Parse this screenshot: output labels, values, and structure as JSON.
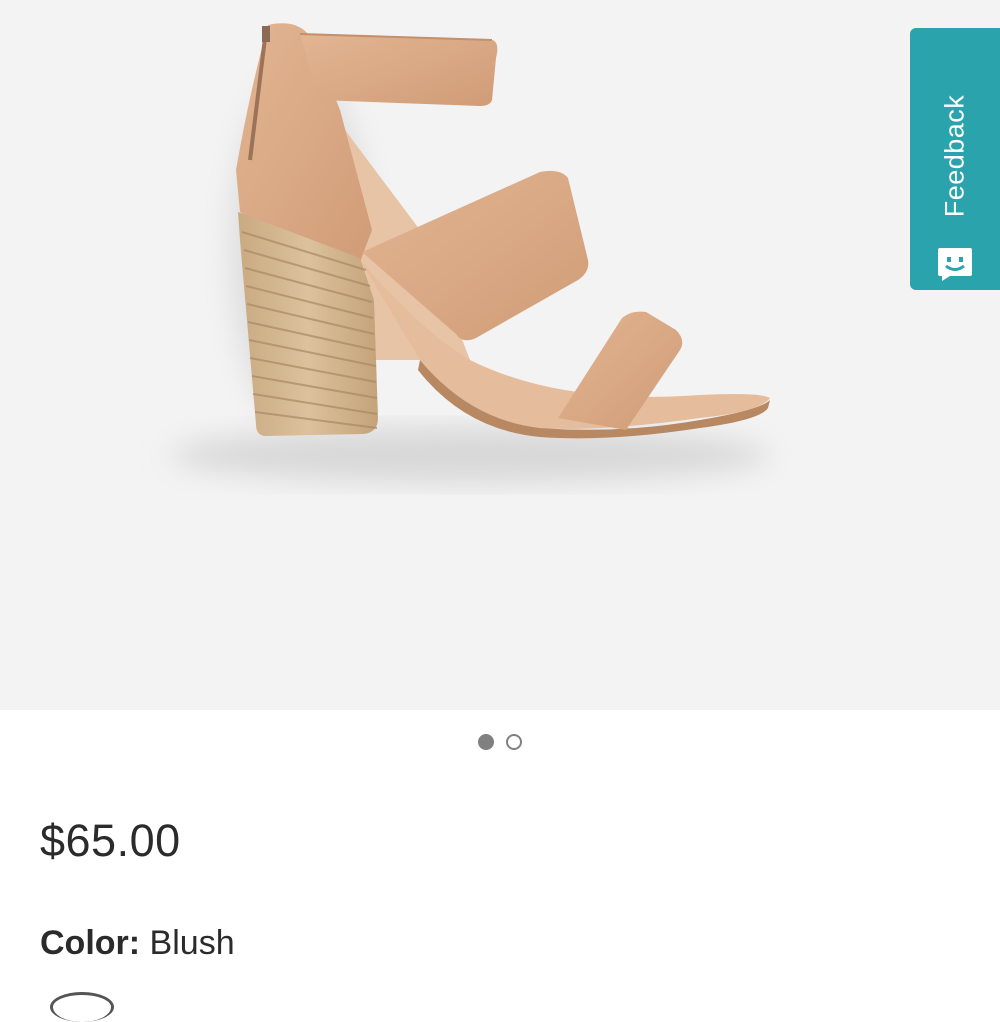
{
  "product": {
    "price": "$65.00",
    "color_label": "Color:",
    "color_value": "Blush",
    "image_subject": "sandal-product-photo"
  },
  "carousel": {
    "total": 2,
    "active_index": 0
  },
  "feedback": {
    "label": "Feedback",
    "icon": "smiley-chat-icon"
  },
  "colors": {
    "feedback_bg": "#2aa3ad",
    "image_bg": "#f3f3f3",
    "text": "#2b2b2b",
    "dot": "#808080",
    "shoe_leather": "#dcab88"
  }
}
